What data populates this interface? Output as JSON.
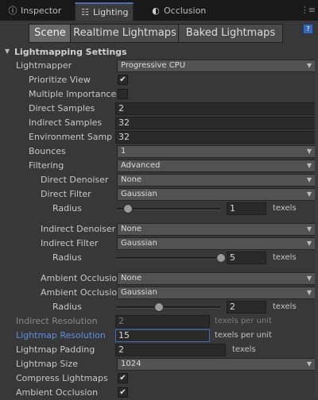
{
  "tabs": [
    {
      "label": "Inspector",
      "icon": "info-icon",
      "glyph": "ⓘ"
    },
    {
      "label": "Lighting",
      "icon": "lighting-icon",
      "glyph": "☷"
    },
    {
      "label": "Occlusion",
      "icon": "occlusion-icon",
      "glyph": "◐"
    }
  ],
  "toolbar": {
    "buttons": [
      "Scene",
      "Realtime Lightmaps",
      "Baked Lightmaps"
    ],
    "help_glyph": "?"
  },
  "section": {
    "title": "Lightmapping Settings"
  },
  "settings": {
    "lightmapper": {
      "label": "Lightmapper",
      "value": "Progressive CPU"
    },
    "prioritize_view": {
      "label": "Prioritize View",
      "checked": "✔"
    },
    "multiple_importance": {
      "label": "Multiple Importance",
      "checked": ""
    },
    "direct_samples": {
      "label": "Direct Samples",
      "value": "2"
    },
    "indirect_samples": {
      "label": "Indirect Samples",
      "value": "32"
    },
    "environment_samples": {
      "label": "Environment Samp",
      "value": "32"
    },
    "bounces": {
      "label": "Bounces",
      "value": "1"
    },
    "filtering": {
      "label": "Filtering",
      "value": "Advanced"
    },
    "direct_denoiser": {
      "label": "Direct Denoiser",
      "value": "None"
    },
    "direct_filter": {
      "label": "Direct Filter",
      "value": "Gaussian"
    },
    "direct_radius": {
      "label": "Radius",
      "value": "1",
      "unit": "texels",
      "slider": 0.1
    },
    "indirect_denoiser": {
      "label": "Indirect Denoiser",
      "value": "None"
    },
    "indirect_filter": {
      "label": "Indirect Filter",
      "value": "Gaussian"
    },
    "indirect_radius": {
      "label": "Radius",
      "value": "5",
      "unit": "texels",
      "slider": 1.0
    },
    "ambient_occlusion_denoiser": {
      "label": "Ambient Occlusio",
      "value": "None"
    },
    "ambient_occlusion_filter": {
      "label": "Ambient Occlusio",
      "value": "Gaussian"
    },
    "ao_radius": {
      "label": "Radius",
      "value": "2",
      "unit": "texels",
      "slider": 0.4
    },
    "indirect_resolution": {
      "label": "Indirect Resolution",
      "value": "2",
      "unit": "texels per unit"
    },
    "lightmap_resolution": {
      "label": "Lightmap Resolution",
      "value": "15",
      "unit": "texels per unit"
    },
    "lightmap_padding": {
      "label": "Lightmap Padding",
      "value": "2",
      "unit": "texels"
    },
    "lightmap_size": {
      "label": "Lightmap Size",
      "value": "1024"
    },
    "compress_lightmaps": {
      "label": "Compress Lightmaps",
      "checked": "✔"
    },
    "ambient_occlusion": {
      "label": "Ambient Occlusion",
      "checked": "✔"
    }
  },
  "colors": {
    "accent": "#3e6bb8",
    "background": "#383838",
    "tabbar": "#191919"
  }
}
